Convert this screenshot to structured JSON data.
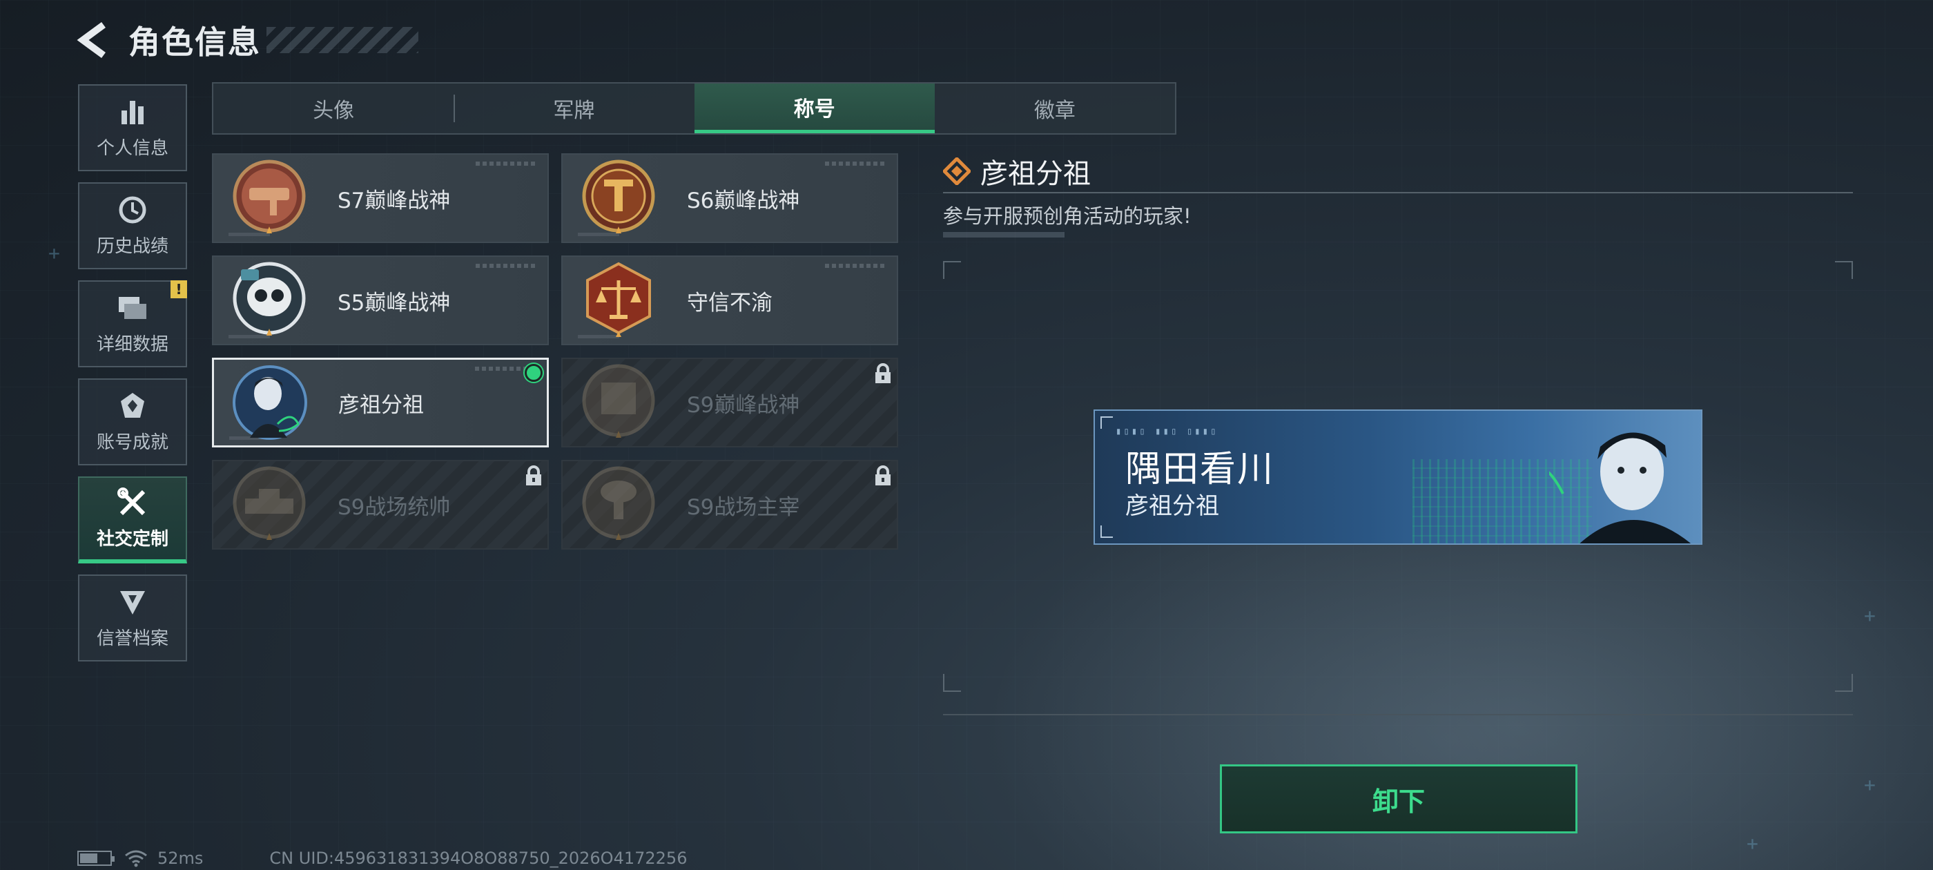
{
  "header": {
    "title": "角色信息"
  },
  "sidebar": {
    "items": [
      {
        "label": "个人信息",
        "icon": "bar-chart-icon"
      },
      {
        "label": "历史战绩",
        "icon": "history-clock-icon"
      },
      {
        "label": "详细数据",
        "icon": "folder-data-icon",
        "badge": "!"
      },
      {
        "label": "账号成就",
        "icon": "achievement-icon"
      },
      {
        "label": "社交定制",
        "icon": "tools-icon",
        "active": true
      },
      {
        "label": "信誉档案",
        "icon": "reputation-icon"
      }
    ]
  },
  "tabs": [
    {
      "label": "头像"
    },
    {
      "label": "军牌"
    },
    {
      "label": "称号",
      "active": true
    },
    {
      "label": "徽章"
    }
  ],
  "titles": [
    {
      "name": "S7巅峰战神",
      "state": "unlocked"
    },
    {
      "name": "S6巅峰战神",
      "state": "unlocked"
    },
    {
      "name": "S5巅峰战神",
      "state": "unlocked"
    },
    {
      "name": "守信不渝",
      "state": "unlocked"
    },
    {
      "name": "彦祖分祖",
      "state": "selected-equipped"
    },
    {
      "name": "S9巅峰战神",
      "state": "locked"
    },
    {
      "name": "S9战场统帅",
      "state": "locked"
    },
    {
      "name": "S9战场主宰",
      "state": "locked"
    }
  ],
  "detail": {
    "title": "彦祖分祖",
    "description": "参与开服预创角活动的玩家!",
    "nameplate": {
      "player_name": "隅田看川",
      "title": "彦祖分祖"
    },
    "unequip_label": "卸下"
  },
  "footer": {
    "ping": "52ms",
    "uid": "CN UID:459631831394O8O88750_2026O4172256",
    "battery_level": 0.55
  },
  "colors": {
    "accent_green": "#37c986",
    "equipped_dot": "#2fd27e",
    "detail_icon": "#e08a3c",
    "warning_badge": "#e3c14a"
  }
}
